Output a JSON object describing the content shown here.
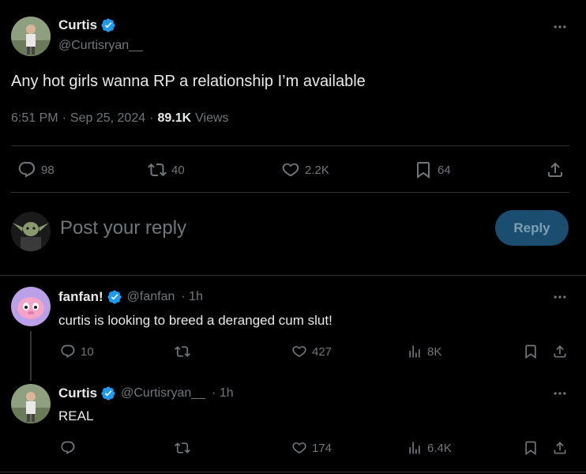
{
  "tweet": {
    "author_name": "Curtis",
    "author_handle": "@Curtisryan__",
    "text": "Any hot girls wanna RP a relationship I’m available",
    "time": "6:51 PM",
    "date": "Sep 25, 2024",
    "views_count": "89.1K",
    "views_label": "Views",
    "separator": "·",
    "stats": {
      "replies": "98",
      "reposts": "40",
      "likes": "2.2K",
      "bookmarks": "64"
    }
  },
  "composer": {
    "placeholder": "Post your reply",
    "reply_label": "Reply"
  },
  "replies": [
    {
      "author_name": "fanfan!",
      "author_handle": "@fanfan",
      "time": "· 1h",
      "text": "curtis is looking to breed a deranged cum slut!",
      "stats": {
        "replies": "10",
        "reposts": "",
        "likes": "427",
        "views": "8K"
      }
    },
    {
      "author_name": "Curtis",
      "author_handle": "@Curtisryan__",
      "time": "· 1h",
      "text": "REAL",
      "stats": {
        "replies": "",
        "reposts": "",
        "likes": "174",
        "views": "6.4K"
      }
    }
  ],
  "colors": {
    "background": "#000000",
    "verified": "#1d9bf0",
    "divider": "#2f3336",
    "muted": "#71767b",
    "reply_button": "#1a4d70"
  }
}
